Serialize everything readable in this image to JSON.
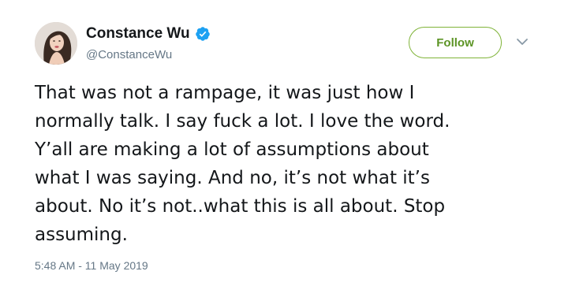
{
  "user": {
    "display_name": "Constance Wu",
    "handle": "@ConstanceWu",
    "verified": true,
    "avatar_icon": "profile-photo"
  },
  "actions": {
    "follow_label": "Follow",
    "more_icon": "chevron-down-icon"
  },
  "tweet": {
    "text_lines": [
      "That was not a rampage, it was just how I",
      "normally talk. I say fuck a lot. I love the word.",
      "Y’all are making a lot of assumptions about",
      "what I was saying. And no, it’s not what it’s",
      "about. No it’s not..what this is all about. Stop",
      "assuming."
    ],
    "timestamp": "5:48 AM - 11 May 2019"
  },
  "colors": {
    "text": "#14171a",
    "secondary": "#657786",
    "follow_accent": "#7fb338",
    "verified_blue": "#1da1f2"
  }
}
